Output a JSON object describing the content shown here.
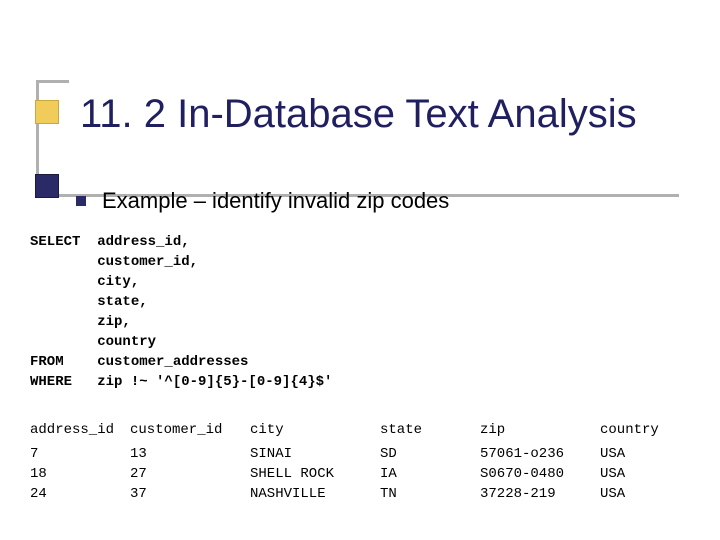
{
  "title": "11. 2 In-Database Text Analysis",
  "bullet": "Example – identify invalid zip codes",
  "sql": {
    "l1": "SELECT  address_id,",
    "l2": "        customer_id,",
    "l3": "        city,",
    "l4": "        state,",
    "l5": "        zip,",
    "l6": "        country",
    "l7": "FROM    customer_addresses",
    "l8": "WHERE   zip !~ '^[0-9]{5}-[0-9]{4}$'"
  },
  "table": {
    "headers": {
      "address_id": "address_id",
      "customer_id": "customer_id",
      "city": "city",
      "state": "state",
      "zip": "zip",
      "country": "country"
    },
    "rows": [
      {
        "address_id": "7",
        "customer_id": "13",
        "city": "SINAI",
        "state": "SD",
        "zip": "57061-o236",
        "country": "USA"
      },
      {
        "address_id": "18",
        "customer_id": "27",
        "city": "SHELL ROCK",
        "state": "IA",
        "zip": "S0670-0480",
        "country": "USA"
      },
      {
        "address_id": "24",
        "customer_id": "37",
        "city": "NASHVILLE",
        "state": "TN",
        "zip": "37228-219",
        "country": "USA"
      }
    ]
  }
}
